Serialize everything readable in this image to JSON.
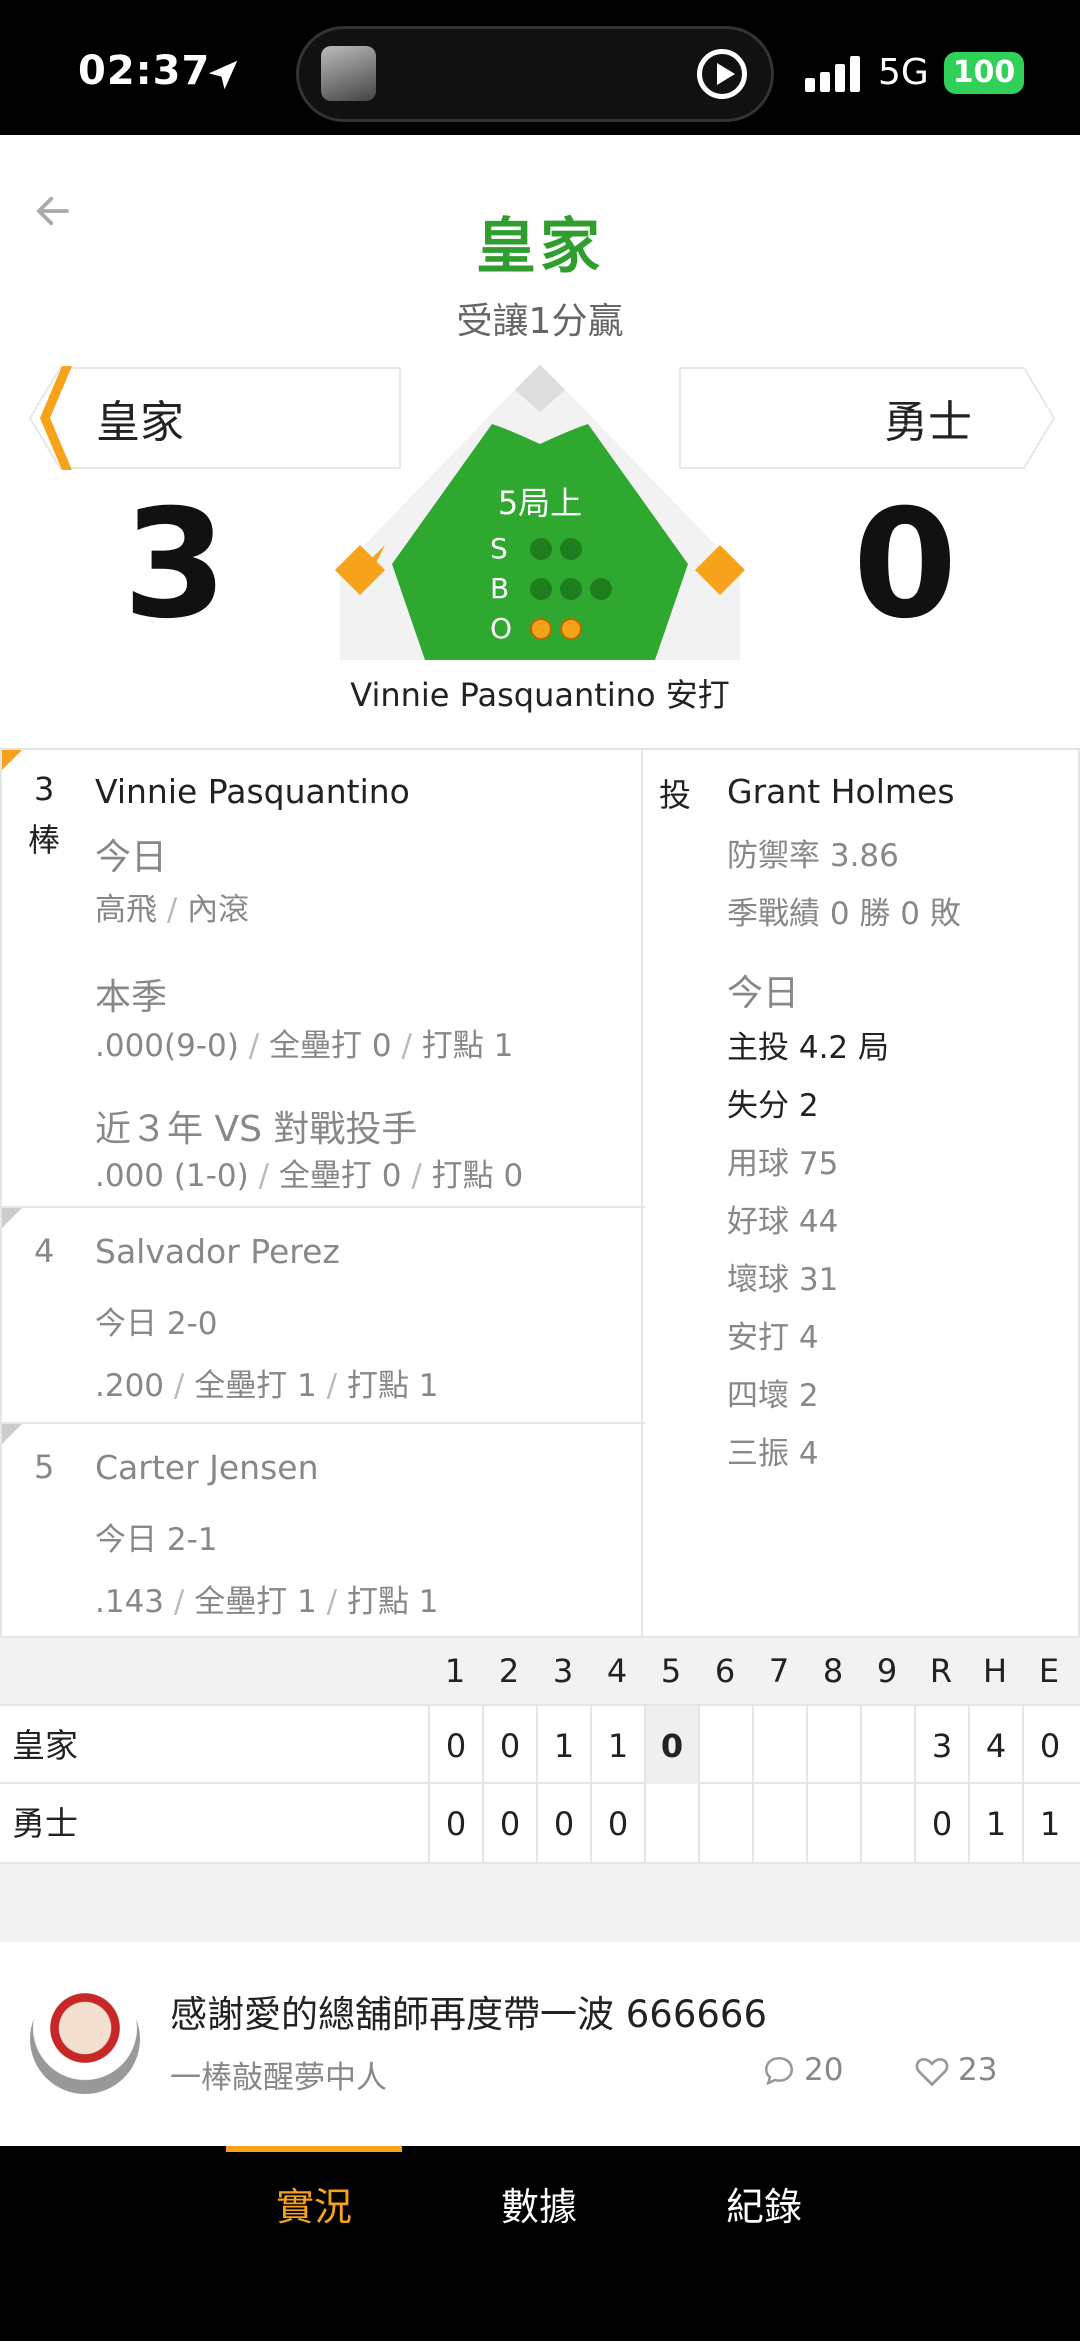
{
  "status_bar": {
    "time": "02:37",
    "network": "5G",
    "battery": "100"
  },
  "header": {
    "title": "皇家",
    "subtitle": "受讓1分贏"
  },
  "scoreboard": {
    "away": {
      "name": "皇家",
      "score": "3"
    },
    "home": {
      "name": "勇士",
      "score": "0"
    },
    "inning": "5局上",
    "count": {
      "s_label": "S",
      "b_label": "B",
      "o_label": "O",
      "strikes": 0,
      "balls": 0,
      "outs": 2
    },
    "last_play": "Vinnie Pasquantino 安打"
  },
  "batters": [
    {
      "order_num": "3",
      "order_suffix": "棒",
      "name": "Vinnie Pasquantino",
      "today_label": "今日",
      "today_results": [
        "高飛",
        "內滾"
      ],
      "season_label": "本季",
      "season_stats": [
        ".000(9-0)",
        "全壘打 0",
        "打點 1"
      ],
      "vs_label": "近３年 VS 對戰投手",
      "vs_stats": [
        ".000 (1-0)",
        "全壘打 0",
        "打點 0"
      ]
    },
    {
      "order_num": "4",
      "name": "Salvador Perez",
      "today": "今日 2-0",
      "stats": [
        ".200",
        "全壘打 1",
        "打點 1"
      ]
    },
    {
      "order_num": "5",
      "name": "Carter Jensen",
      "today": "今日 2-1",
      "stats": [
        ".143",
        "全壘打 1",
        "打點 1"
      ]
    }
  ],
  "pitcher": {
    "label": "投",
    "name": "Grant Holmes",
    "era": "防禦率 3.86",
    "record": "季戰績 0 勝 0 敗",
    "today_label": "今日",
    "lines": [
      "主投 4.2 局",
      "失分 2",
      "用球 75",
      "好球 44",
      "壞球 31",
      "安打 4",
      "四壞 2",
      "三振 4"
    ]
  },
  "box_score": {
    "headers": [
      "1",
      "2",
      "3",
      "4",
      "5",
      "6",
      "7",
      "8",
      "9",
      "R",
      "H",
      "E"
    ],
    "rows": [
      {
        "team": "皇家",
        "cells": [
          "0",
          "0",
          "1",
          "1",
          "0",
          "",
          "",
          "",
          "",
          "3",
          "4",
          "0"
        ]
      },
      {
        "team": "勇士",
        "cells": [
          "0",
          "0",
          "0",
          "0",
          "",
          "",
          "",
          "",
          "",
          "0",
          "1",
          "1"
        ]
      }
    ]
  },
  "comment": {
    "text": "感謝愛的總舖師再度帶一波 666666",
    "user": "一棒敲醒夢中人",
    "replies": "20",
    "likes": "23"
  },
  "tabs": [
    {
      "label": "實況",
      "active": true
    },
    {
      "label": "數據",
      "active": false
    },
    {
      "label": "紀錄",
      "active": false
    }
  ],
  "colors": {
    "accent": "#f7a21b",
    "field_green": "#2fa82f",
    "title_green": "#2f9e2f"
  }
}
